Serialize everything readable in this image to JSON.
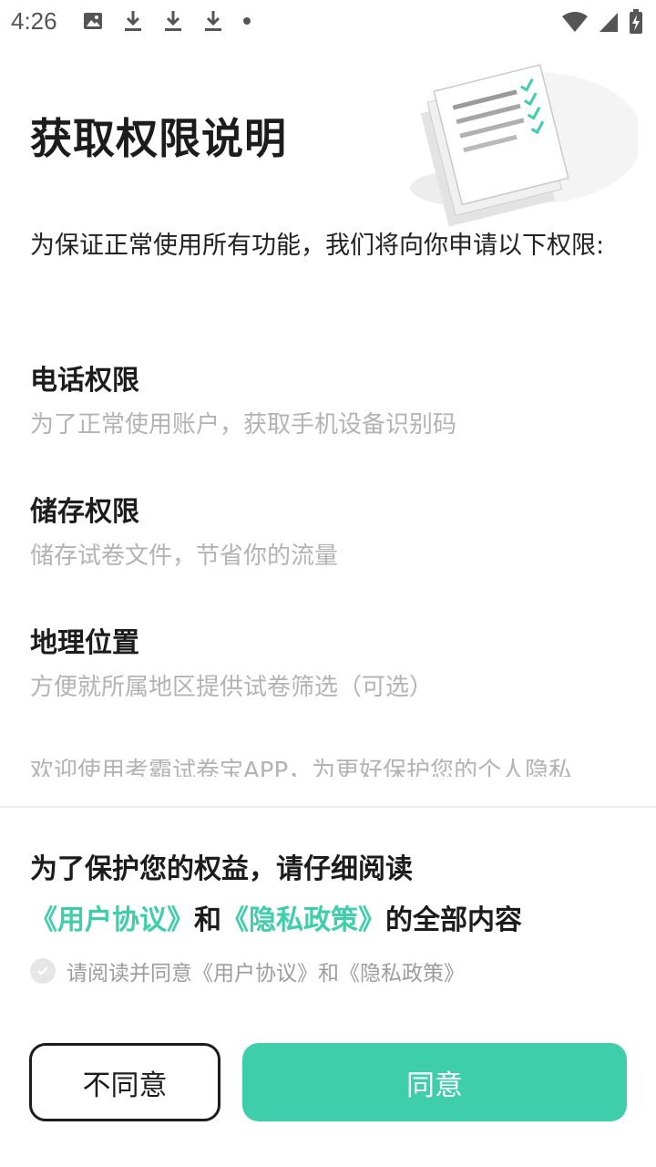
{
  "status_bar": {
    "time": "4:26",
    "left_icons": [
      "image-icon",
      "download-icon",
      "download-icon",
      "download-icon",
      "dot-icon"
    ],
    "right_icons": [
      "wifi-icon",
      "signal-icon",
      "battery-charging-icon"
    ]
  },
  "header": {
    "title": "获取权限说明"
  },
  "intro": "为保证正常使用所有功能，我们将向你申请以下权限:",
  "permissions": [
    {
      "title": "电话权限",
      "desc": "为了正常使用账户，获取手机设备识别码"
    },
    {
      "title": "储存权限",
      "desc": "储存试卷文件，节省你的流量"
    },
    {
      "title": "地理位置",
      "desc": "方便就所属地区提供试卷筛选（可选）"
    }
  ],
  "cut_text": "欢迎使用考霸试卷宝APP，为更好保护您的个人隐私",
  "notice": {
    "line1": "为了保护您的权益，请仔细阅读",
    "user_agreement": "《用户协议》",
    "and": "和",
    "privacy_policy": "《隐私政策》",
    "tail": "的全部内容"
  },
  "agree_checkbox": {
    "label": "请阅读并同意《用户协议》和《隐私政策》"
  },
  "buttons": {
    "disagree": "不同意",
    "agree": "同意"
  },
  "colors": {
    "accent": "#3ecfaa",
    "muted_text": "#b3b3b3",
    "primary_text": "#1c1c1c"
  }
}
